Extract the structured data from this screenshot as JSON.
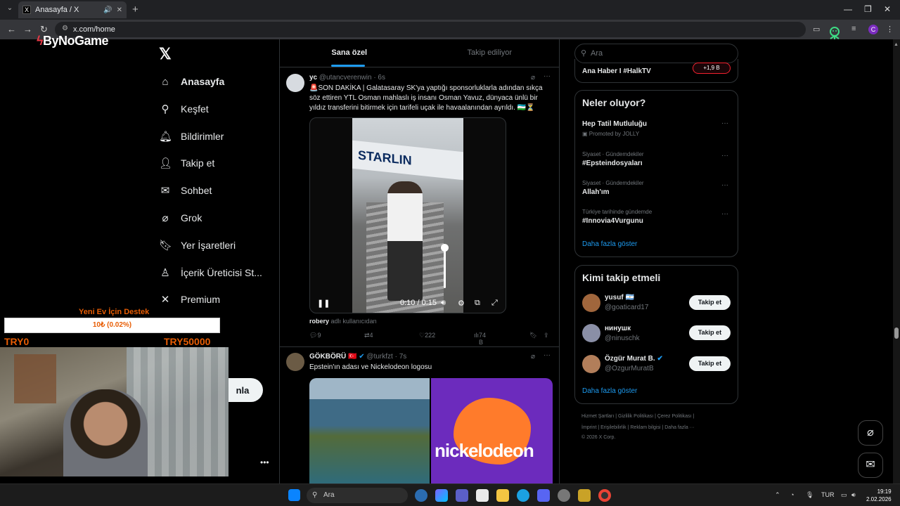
{
  "browser": {
    "tab_title": "Anasayfa / X",
    "tab_favicon": "X",
    "url": "x.com/home",
    "profile_initial": "C"
  },
  "overlay": {
    "brand": "ByNoGame",
    "donate_title": "Yeni Ev İçin Destek",
    "donate_progress_text": "10₺ (0.02%)",
    "donate_progress_fraction": 0.0002,
    "donate_min": "TRY0",
    "donate_max": "TRY50000"
  },
  "nav": {
    "items": [
      {
        "label": "Anasayfa",
        "icon": "home-icon"
      },
      {
        "label": "Keşfet",
        "icon": "search-icon"
      },
      {
        "label": "Bildirimler",
        "icon": "bell-icon"
      },
      {
        "label": "Takip et",
        "icon": "person-add-icon"
      },
      {
        "label": "Sohbet",
        "icon": "mail-icon"
      },
      {
        "label": "Grok",
        "icon": "grok-icon"
      },
      {
        "label": "Yer İşaretleri",
        "icon": "bookmark-icon"
      },
      {
        "label": "İçerik Üreticisi St...",
        "icon": "creator-icon"
      },
      {
        "label": "Premium",
        "icon": "x-icon"
      }
    ],
    "post_button_partial": "nla"
  },
  "timeline": {
    "tabs": [
      "Sana özel",
      "Takip ediliyor"
    ],
    "tweet1": {
      "name": "yc",
      "handle": "@utancverenwin",
      "time": "· 6s",
      "text": "🚨SON DAKİKA | Galatasaray SK'ya yaptığı sponsorluklarla adından sıkça söz ettiren YTL Osman mahlaslı iş insanı Osman Yavuz, dünyaca ünlü bir yıldız transferini bitirmek için tarifeli uçak ile havaalanından ayrıldı. 🇺🇿⏳",
      "video_time": "0:10 / 0:15",
      "plane_text": "STARLIN",
      "caption_user": "robery",
      "caption_rest": "adlı kullanıcıdan",
      "replies": "9",
      "reposts": "4",
      "likes": "222",
      "views": "74 B"
    },
    "tweet2": {
      "name": "GÖKBÖRÜ",
      "handle": "@turkfzt",
      "time": "· 7s",
      "text": "Epstein'ın adası ve Nickelodeon logosu",
      "image_text": "nickelodeon"
    }
  },
  "sidebar": {
    "search_placeholder": "Ara",
    "live_item": "Ana Haber I #HalkTV",
    "live_badge": "+1,9 B",
    "trends_title": "Neler oluyor?",
    "trends": [
      {
        "context": "",
        "title": "Hep Tatil Mutluluğu",
        "sub": "Promoted by JOLLY"
      },
      {
        "context": "Siyaset · Gündemdekiler",
        "title": "#Epsteindosyaları",
        "sub": ""
      },
      {
        "context": "Siyaset · Gündemdekiler",
        "title": "Allah'ım",
        "sub": ""
      },
      {
        "context": "Türkiye tarihinde gündemde",
        "title": "#Innovia4Vurgunu",
        "sub": ""
      }
    ],
    "show_more": "Daha fazla göster",
    "wtf_title": "Kimi takip etmeli",
    "wtf": [
      {
        "name": "yusuf 🇦🇷",
        "handle": "@goaticard17",
        "button": "Takip et"
      },
      {
        "name": "нинушк",
        "handle": "@ninuschk",
        "button": "Takip et"
      },
      {
        "name": "Özgür Murat B.",
        "handle": "@OzgurMuratB",
        "button": "Takip et"
      }
    ],
    "footer_line1": "Hizmet Şartları  |  Gizlilik Politikası  |  Çerez Politikası  |",
    "footer_line2": "İmprint  |  Erişilebilirlik  |  Reklam bilgisi  |  Daha fazla ···",
    "footer_line3": "© 2026 X Corp."
  },
  "taskbar": {
    "search_placeholder": "Ara",
    "lang": "TUR",
    "time": "19:19",
    "date": "2.02.2026"
  },
  "colors": {
    "accent": "#1d9bf0",
    "donate": "#e85d04"
  }
}
